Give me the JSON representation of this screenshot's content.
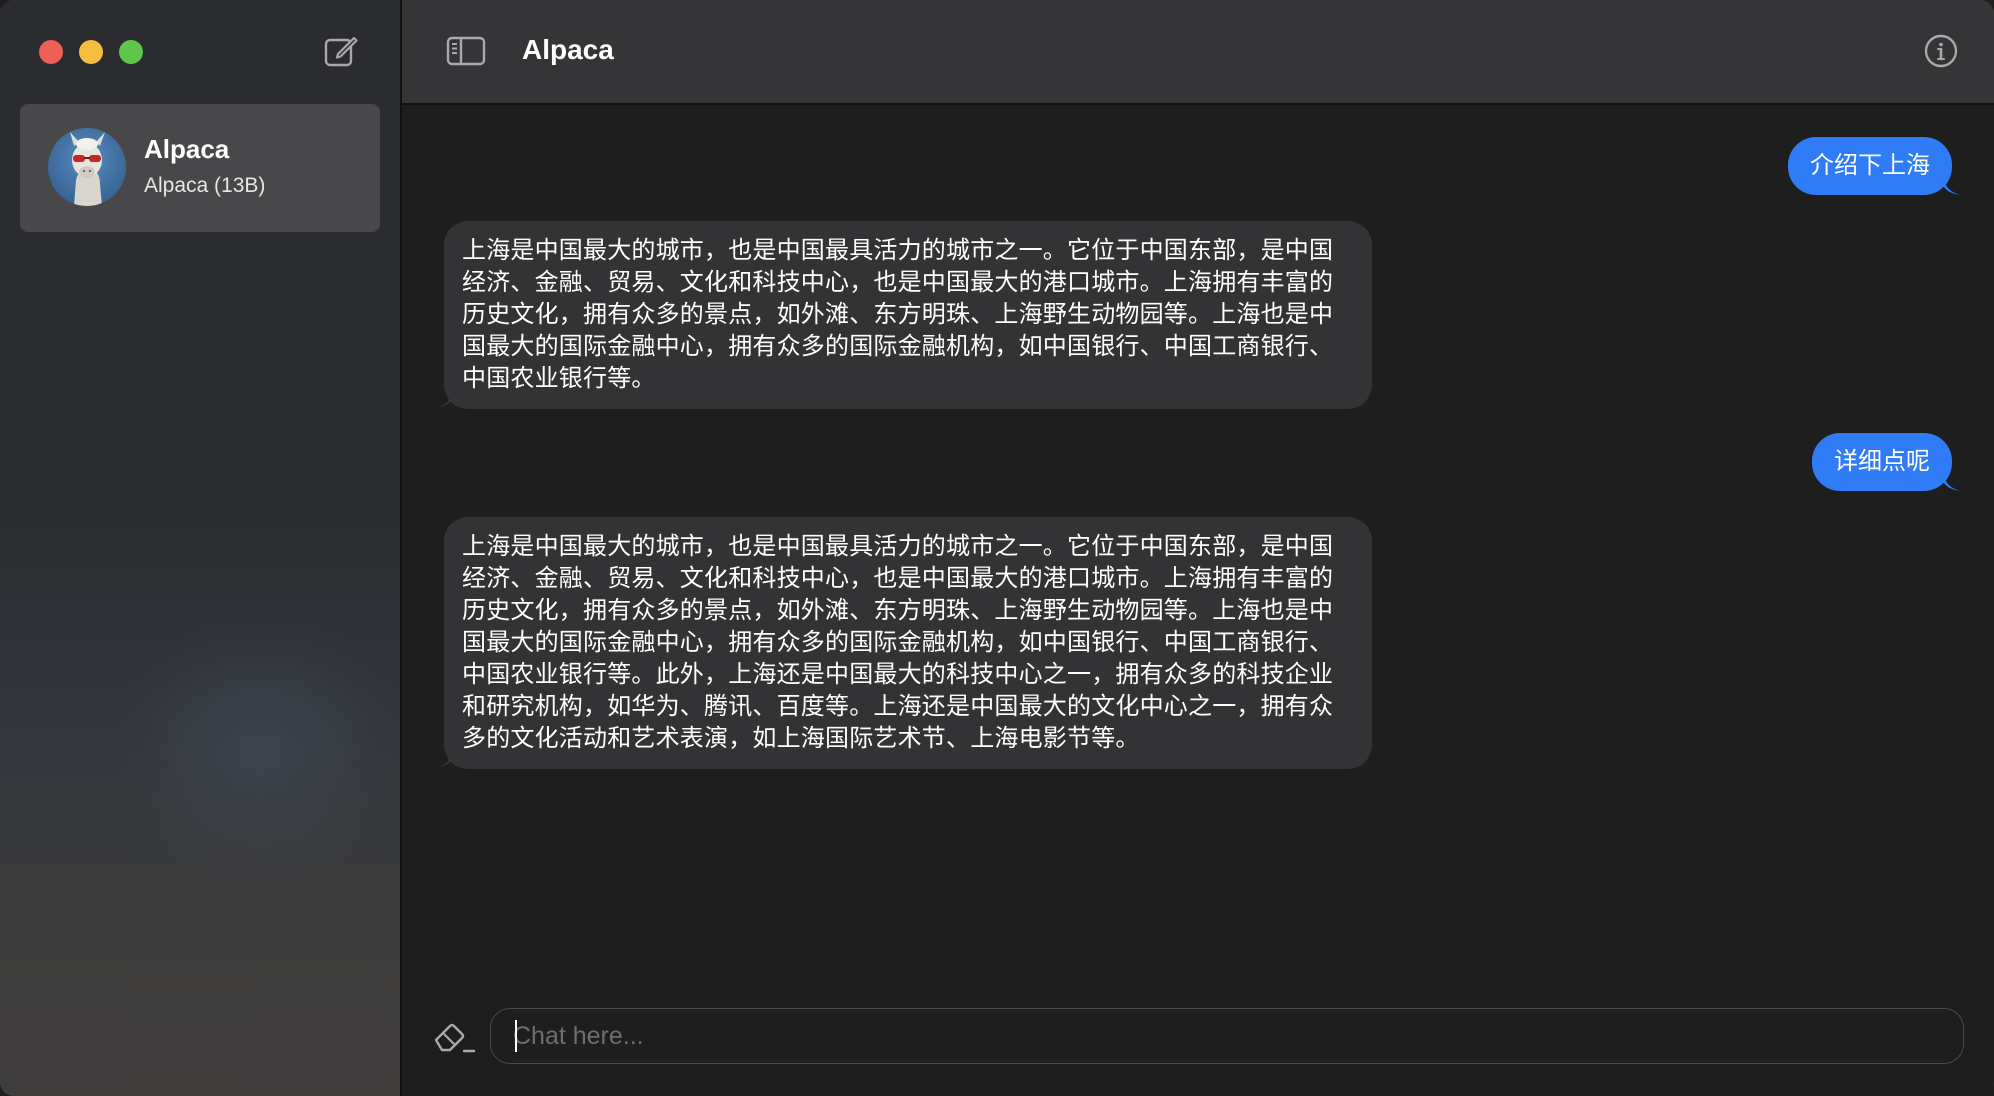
{
  "window": {
    "title": "Alpaca"
  },
  "sidebar": {
    "conversations": [
      {
        "title": "Alpaca",
        "subtitle": "Alpaca (13B)"
      }
    ]
  },
  "toolbar": {
    "title": "Alpaca"
  },
  "messages": [
    {
      "role": "user",
      "text": "介绍下上海"
    },
    {
      "role": "assistant",
      "text": "上海是中国最大的城市，也是中国最具活力的城市之一。它位于中国东部，是中国经济、金融、贸易、文化和科技中心，也是中国最大的港口城市。上海拥有丰富的历史文化，拥有众多的景点，如外滩、东方明珠、上海野生动物园等。上海也是中国最大的国际金融中心，拥有众多的国际金融机构，如中国银行、中国工商银行、中国农业银行等。"
    },
    {
      "role": "user",
      "text": "详细点呢"
    },
    {
      "role": "assistant",
      "text": "上海是中国最大的城市，也是中国最具活力的城市之一。它位于中国东部，是中国经济、金融、贸易、文化和科技中心，也是中国最大的港口城市。上海拥有丰富的历史文化，拥有众多的景点，如外滩、东方明珠、上海野生动物园等。上海也是中国最大的国际金融中心，拥有众多的国际金融机构，如中国银行、中国工商银行、中国农业银行等。此外，上海还是中国最大的科技中心之一，拥有众多的科技企业和研究机构，如华为、腾讯、百度等。上海还是中国最大的文化中心之一，拥有众多的文化活动和艺术表演，如上海国际艺术节、上海电影节等。"
    }
  ],
  "composer": {
    "placeholder": "Chat here...",
    "value": ""
  },
  "colors": {
    "user_bubble": "#2f7cf6",
    "assistant_bubble": "#333335",
    "close": "#ed5f57",
    "minimize": "#f5bd3f",
    "maximize": "#5fc64a"
  },
  "icons": {
    "compose": "compose-icon",
    "sidebar_toggle": "sidebar-toggle-icon",
    "info": "info-icon",
    "clear": "eraser-icon",
    "avatar": "alpaca-avatar"
  }
}
